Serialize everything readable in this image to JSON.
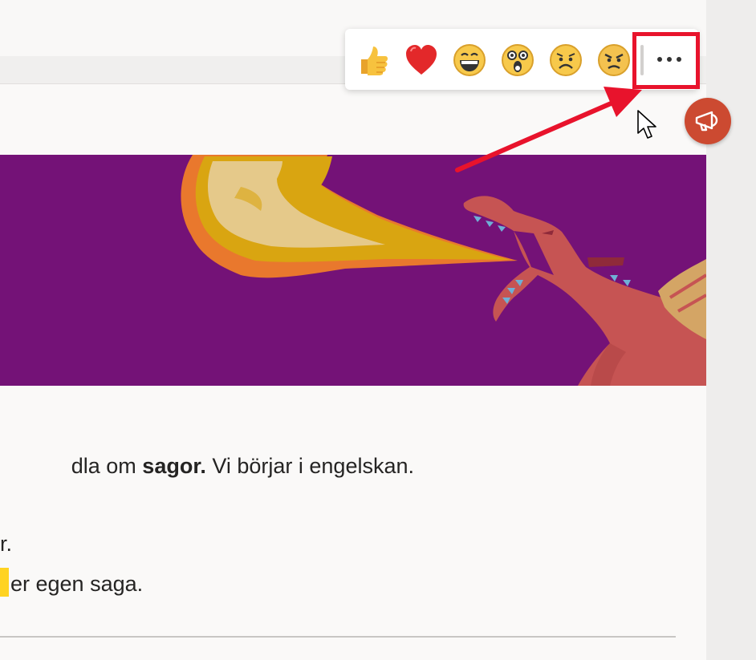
{
  "reactions": {
    "items": [
      {
        "name": "like",
        "icon": "thumbs-up-icon"
      },
      {
        "name": "heart",
        "icon": "heart-icon"
      },
      {
        "name": "laugh",
        "icon": "laughing-face-icon"
      },
      {
        "name": "surprised",
        "icon": "surprised-face-icon"
      },
      {
        "name": "sad",
        "icon": "sad-face-icon"
      },
      {
        "name": "angry",
        "icon": "angry-face-icon"
      }
    ],
    "more_icon": "more-options-icon"
  },
  "announcement_icon": "megaphone-icon",
  "post": {
    "line1_prefix": "dla om ",
    "line1_bold": "sagor.",
    "line1_suffix": " Vi börjar i engelskan.",
    "line2": "r.",
    "line3": "er egen saga."
  },
  "colors": {
    "banner_bg": "#741277",
    "annotation_red": "#e8132c",
    "announce_bg": "#cc4a31",
    "highlight": "#ffd321"
  }
}
